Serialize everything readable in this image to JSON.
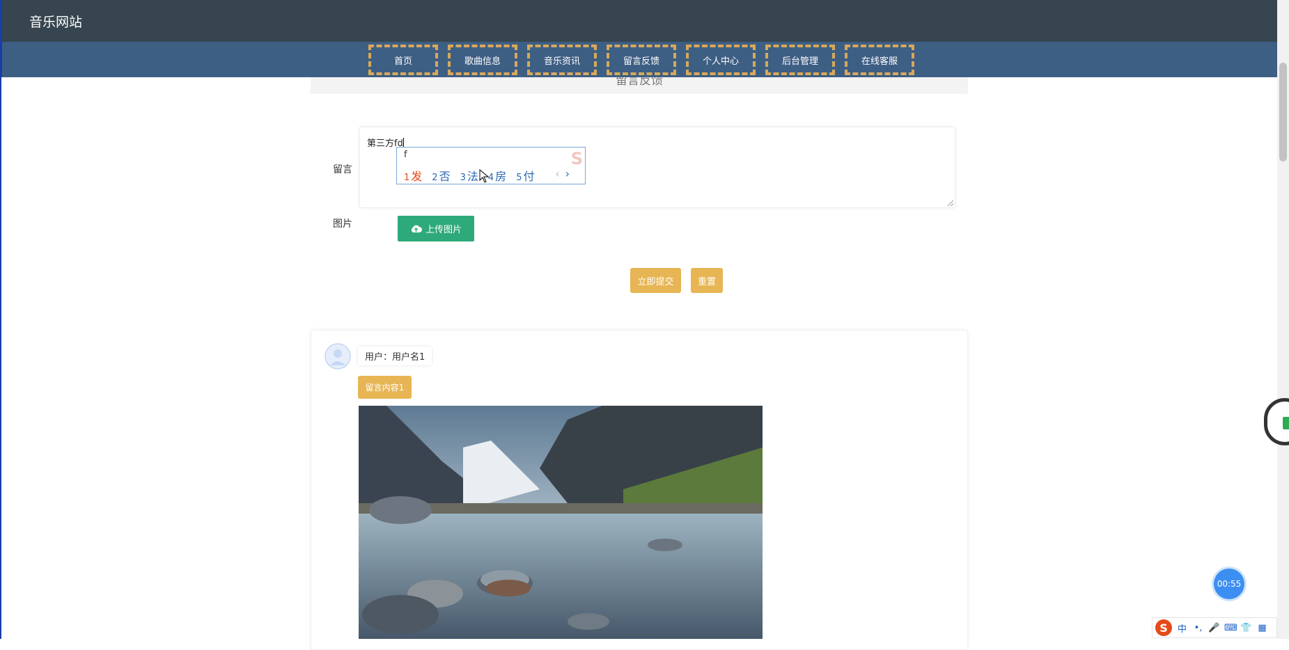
{
  "header": {
    "site_title": "音乐网站"
  },
  "nav": {
    "items": [
      "首页",
      "歌曲信息",
      "音乐资讯",
      "留言反馈",
      "个人中心",
      "后台管理",
      "在线客服"
    ]
  },
  "page": {
    "section_title": "留言反馈"
  },
  "form": {
    "message_label": "留言",
    "message_value": "第三方fd",
    "image_label": "图片",
    "upload_label": "上传图片",
    "submit_label": "立即提交",
    "reset_label": "重置"
  },
  "ime": {
    "composition": "f",
    "candidates": [
      {
        "num": "1",
        "text": "发"
      },
      {
        "num": "2",
        "text": "否"
      },
      {
        "num": "3",
        "text": "法"
      },
      {
        "num": "4",
        "text": "房"
      },
      {
        "num": "5",
        "text": "付"
      }
    ],
    "toolbar_mode": "中"
  },
  "messages": [
    {
      "user_text": "用户：用户名1",
      "content": "留言内容1"
    }
  ],
  "timer": {
    "value": "00:55"
  },
  "colors": {
    "topbar": "#36454f",
    "navbar": "#3e5f84",
    "accent": "#e7b553",
    "upload": "#2eaa7a"
  }
}
